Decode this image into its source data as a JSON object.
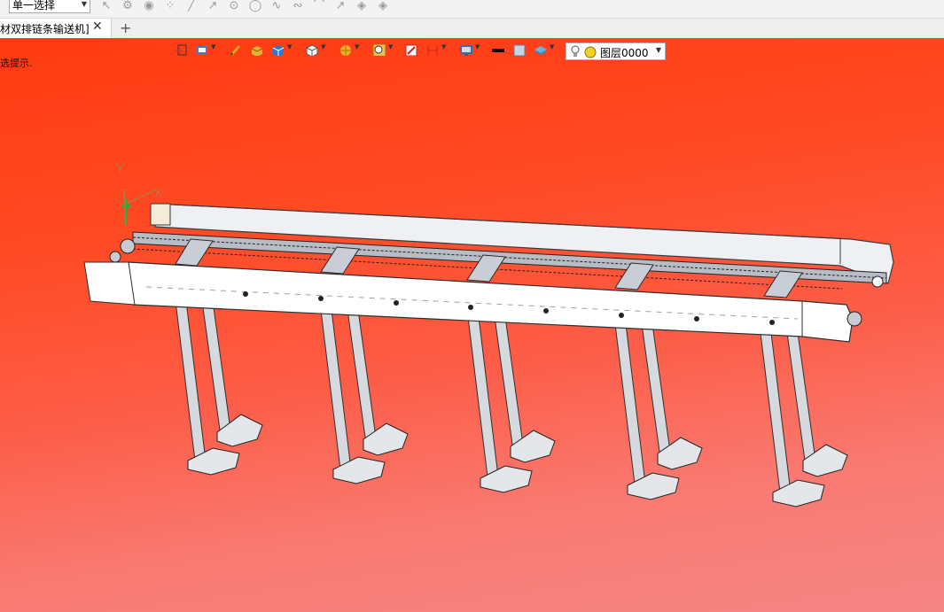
{
  "toolbar": {
    "selection_mode": "单一选择",
    "icons": [
      "pointer-icon",
      "filter-icon",
      "play-icon",
      "snap-icon",
      "line-icon",
      "ray-icon",
      "point-circle-icon",
      "circle-icon",
      "spline-icon",
      "curve-icon",
      "arc-icon",
      "arrow-line-icon",
      "layer-stack-icon",
      "layer-move-icon"
    ]
  },
  "tabs": [
    {
      "label": "材双排链条输送机]",
      "active": true
    }
  ],
  "tab_add": "+",
  "tab_close": "✕",
  "hint": "选提示.",
  "view_toolbar": {
    "layer_name": "图层0000"
  },
  "colors": {
    "viewport_top": "#ff3a10",
    "viewport_bottom": "#f58584",
    "frame": "#d6d9de",
    "frame_edge": "#3a3a3a"
  },
  "triad": {
    "y_label": "Y",
    "x_label": "X"
  }
}
